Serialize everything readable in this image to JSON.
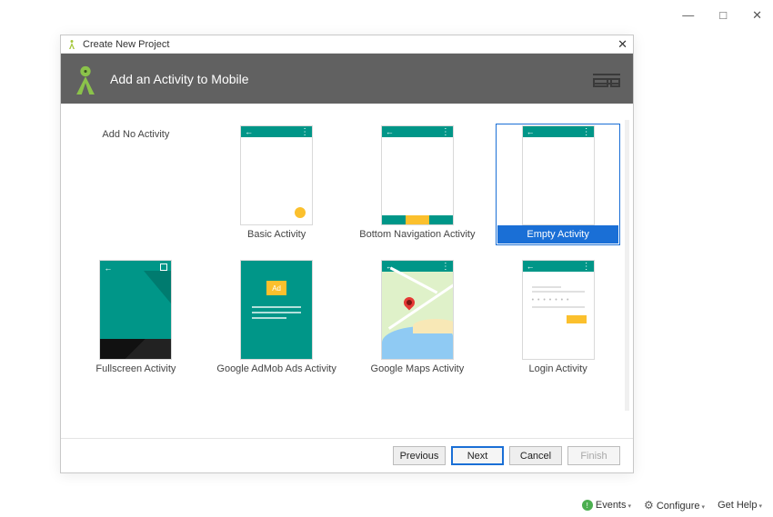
{
  "window": {
    "minimize": "—",
    "maximize": "□",
    "close": "✕"
  },
  "dialog": {
    "title": "Create New Project",
    "close": "✕",
    "header": "Add an Activity to Mobile"
  },
  "activities": [
    {
      "id": "no-activity",
      "label": "Add No Activity",
      "thumb": "none",
      "selected": false
    },
    {
      "id": "basic",
      "label": "Basic Activity",
      "thumb": "basic",
      "selected": false
    },
    {
      "id": "bottom-nav",
      "label": "Bottom Navigation Activity",
      "thumb": "bottomnav",
      "selected": false
    },
    {
      "id": "empty",
      "label": "Empty Activity",
      "thumb": "empty",
      "selected": true
    },
    {
      "id": "fullscreen",
      "label": "Fullscreen Activity",
      "thumb": "fullscreen",
      "selected": false
    },
    {
      "id": "admob",
      "label": "Google AdMob Ads Activity",
      "thumb": "admob",
      "selected": false
    },
    {
      "id": "maps",
      "label": "Google Maps Activity",
      "thumb": "maps",
      "selected": false
    },
    {
      "id": "login",
      "label": "Login Activity",
      "thumb": "login",
      "selected": false
    }
  ],
  "admob_badge": "Ad",
  "footer": {
    "previous": "Previous",
    "next": "Next",
    "cancel": "Cancel",
    "finish": "Finish"
  },
  "statusbar": {
    "events": "Events",
    "configure": "Configure",
    "gethelp": "Get Help"
  }
}
